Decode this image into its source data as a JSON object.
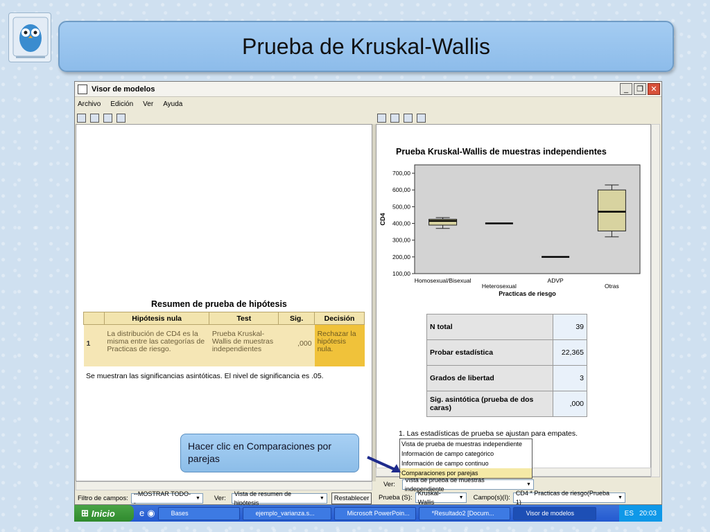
{
  "slide": {
    "title": "Prueba de Kruskal-Wallis",
    "callout": "Hacer clic en Comparaciones por parejas"
  },
  "window": {
    "title": "Visor de modelos",
    "menu": [
      "Archivo",
      "Edición",
      "Ver",
      "Ayuda"
    ]
  },
  "left_pane": {
    "table_title": "Resumen de prueba de hipótesis",
    "headers": [
      "Hipótesis nula",
      "Test",
      "Sig.",
      "Decisión"
    ],
    "row": {
      "num": "1",
      "hypothesis": "La distribución de CD4 es la misma entre las categorías de Practicas de riesgo.",
      "test": "Prueba Kruskal-Wallis de muestras independientes",
      "sig": ",000",
      "decision": "Rechazar la hipótesis nula."
    },
    "footnote": "Se muestran las significancias asintóticas.  El nivel de significancia es .05."
  },
  "right_pane": {
    "chart_title": "Prueba Kruskal-Wallis de muestras independientes",
    "note": "1.  Las estadísticas de prueba se ajustan para empates.",
    "stats": [
      {
        "label": "N total",
        "value": "39"
      },
      {
        "label": "Probar estadística",
        "value": "22,365"
      },
      {
        "label": "Grados de libertad",
        "value": "3"
      },
      {
        "label": "Sig. asintótica (prueba de dos caras)",
        "value": ",000"
      }
    ]
  },
  "chart_data": {
    "type": "boxplot",
    "title": "",
    "xlabel": "Practicas de riesgo",
    "ylabel": "CD4",
    "ylim": [
      100,
      750
    ],
    "yticks": [
      "100,00",
      "200,00",
      "300,00",
      "400,00",
      "500,00",
      "600,00",
      "700,00"
    ],
    "categories": [
      "Homosexual/Bisexual",
      "Heterosexual",
      "ADVP",
      "Otras"
    ],
    "boxes": [
      {
        "min": 370,
        "q1": 390,
        "median": 415,
        "q3": 425,
        "max": 435
      },
      {
        "min": 400,
        "q1": 400,
        "median": 400,
        "q3": 400,
        "max": 400
      },
      {
        "min": 200,
        "q1": 200,
        "median": 200,
        "q3": 200,
        "max": 200
      },
      {
        "min": 320,
        "q1": 355,
        "median": 470,
        "q3": 600,
        "max": 630
      }
    ],
    "colors": {
      "box": "#d8d3a0",
      "plot_bg": "#d3d3d3"
    },
    "grid": false
  },
  "dropdown": {
    "options": [
      "Vista de prueba de muestras independiente",
      "Información de campo categórico",
      "Información de campo continuo",
      "Comparaciones por parejas"
    ],
    "highlighted": "Comparaciones por parejas"
  },
  "bottom_left": {
    "filter_label": "Filtro de campos:",
    "filter_value": "--MOSTRAR TODO--",
    "ver_label": "Ver:",
    "ver_value": "Vista de resumen de hipótesis",
    "reset": "Restablecer"
  },
  "bottom_right": {
    "ver_label": "Ver:",
    "ver_value": "Vista de prueba de muestras independiente",
    "prueba_label": "Prueba (S):",
    "prueba_value": "Kruskal-Wallis",
    "campo_label": "Campo(s)(I):",
    "campo_value": "CD4 * Practicas de riesgo(Prueba 1)"
  },
  "taskbar": {
    "start": "Inicio",
    "tasks": [
      "Bases",
      "ejemplo_varianza.s...",
      "Microsoft PowerPoin...",
      "*Resultado2 [Docum...",
      "Visor de modelos"
    ],
    "lang": "ES",
    "time": "20:03"
  }
}
